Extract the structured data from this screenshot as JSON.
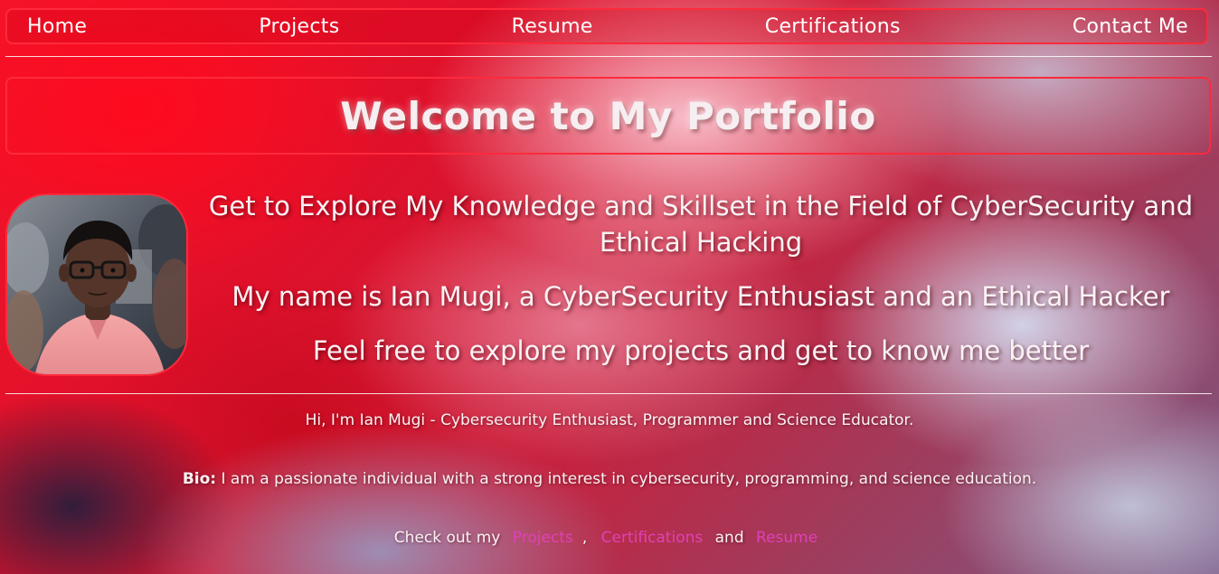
{
  "nav": {
    "items": [
      {
        "label": "Home"
      },
      {
        "label": "Projects"
      },
      {
        "label": "Resume"
      },
      {
        "label": "Certifications"
      },
      {
        "label": "Contact Me"
      }
    ]
  },
  "banner": {
    "title": "Welcome to My Portfolio"
  },
  "intro": {
    "line1": "Get to Explore My Knowledge and Skillset in the Field of CyberSecurity and Ethical Hacking",
    "line2": "My name is Ian Mugi, a CyberSecurity Enthusiast and an Ethical Hacker",
    "line3": "Feel free to explore my projects and get to know me better"
  },
  "bio": {
    "greeting": "Hi, I'm Ian Mugi - Cybersecurity Enthusiast, Programmer and Science Educator.",
    "label": "Bio:",
    "text": " I am a passionate individual with a strong interest in cybersecurity, programming, and science education.",
    "cta_prefix": "Check out my",
    "cta_projects": "Projects",
    "cta_comma": ",",
    "cta_certifications": "Certifications",
    "cta_and": "and",
    "cta_resume": "Resume"
  },
  "colors": {
    "accent_border": "#ff2a3c",
    "link": "#e040b8"
  }
}
